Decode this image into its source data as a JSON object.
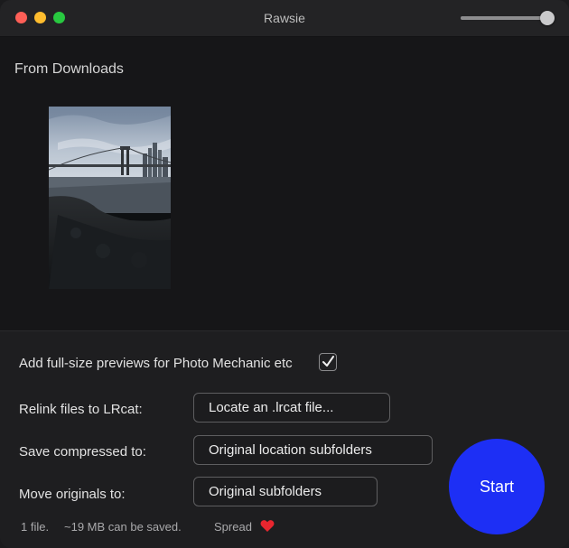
{
  "window": {
    "title": "Rawsie",
    "size_slider": {
      "value": 0.92
    }
  },
  "source": {
    "folder_label": "From Downloads",
    "thumbnail": "brooklyn-bridge-photo"
  },
  "options": {
    "previews_label": "Add full-size previews for Photo Mechanic etc",
    "previews_checked": true,
    "relink_label": "Relink files to LRcat:",
    "relink_button": "Locate an .lrcat file...",
    "save_label": "Save compressed to:",
    "save_value": "Original location subfolders",
    "move_label": "Move originals to:",
    "move_value": "Original subfolders"
  },
  "actions": {
    "start_label": "Start"
  },
  "status": {
    "file_count": "1 file.",
    "savings": "~19 MB can be saved.",
    "spread": "Spread",
    "spread_icon": "heart-icon"
  },
  "colors": {
    "start_button": "#1d2ff5",
    "heart": "#e8262f",
    "close": "#fe5f57",
    "minimize": "#febc2e",
    "zoom": "#28c840"
  }
}
